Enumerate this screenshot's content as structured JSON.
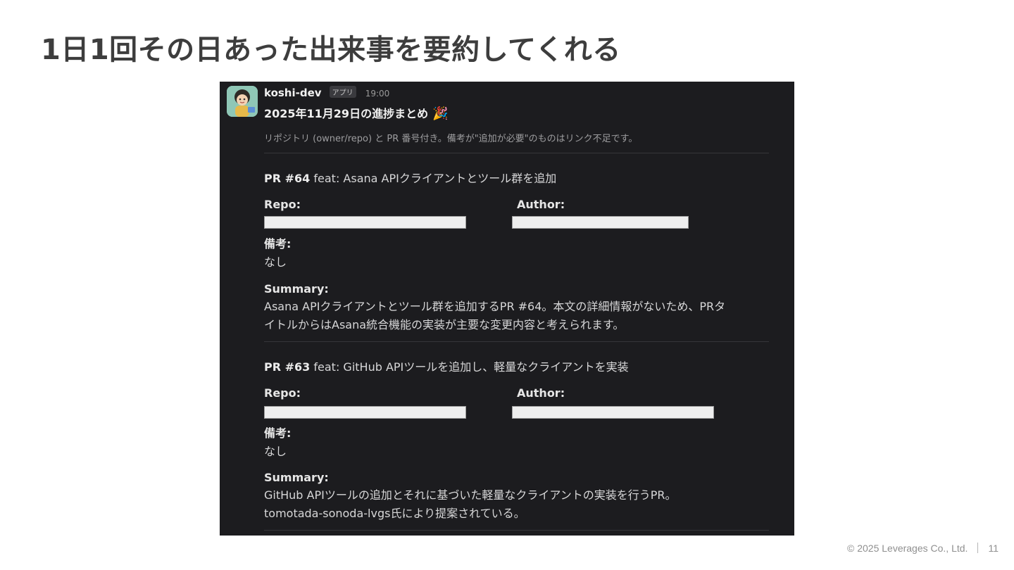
{
  "slide": {
    "title": "1日1回その日あった出来事を要約してくれる",
    "footer_copyright": "© 2025 Leverages Co., Ltd.",
    "page_number": "11"
  },
  "message": {
    "sender": "koshi-dev",
    "badge": "アプリ",
    "time": "19:00",
    "title": "2025年11月29日の進捗まとめ",
    "title_emoji": "🎉",
    "context": "リポジトリ (owner/repo) と PR 番号付き。備考が\"追加が必要\"のものはリンク不足です。",
    "avatar_icon": "bot-avatar"
  },
  "labels": {
    "repo": "Repo:",
    "author": "Author:",
    "notes": "備考:",
    "summary": "Summary:"
  },
  "prs": [
    {
      "number": "PR #64",
      "title": "feat: Asana APIクライアントとツール群を追加",
      "notes": "なし",
      "summary_lines": [
        "Asana APIクライアントとツール群を追加するPR #64。本文の詳細情報がないため、PRタ",
        "イトルからはAsana統合機能の実装が主要な変更内容と考えられます。"
      ]
    },
    {
      "number": "PR #63",
      "title": "feat: GitHub APIツールを追加し、軽量なクライアントを実装",
      "notes": "なし",
      "summary_lines": [
        "GitHub APIツールの追加とそれに基づいた軽量なクライアントの実装を行うPR。",
        "tomotada-sonoda-lvgs氏により提案されている。"
      ]
    }
  ],
  "colors": {
    "slack_bg": "#1c1c1f",
    "title_gray": "#3d3d3d",
    "redaction": "#eeeeee"
  }
}
